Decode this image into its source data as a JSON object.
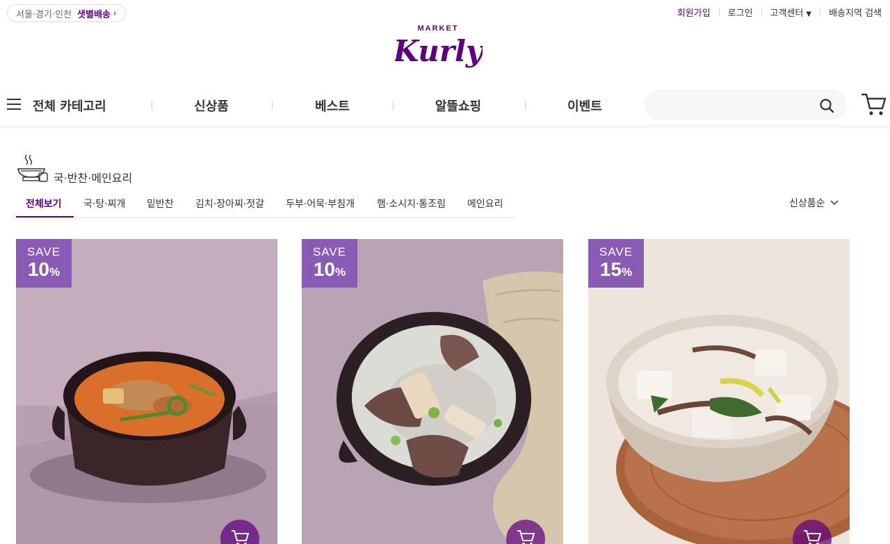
{
  "header": {
    "delivery_region": "서울·경기·인천",
    "delivery_link": "샛별배송",
    "user_menu": [
      "회원가입",
      "로그인",
      "고객센터",
      "배송지역 검색"
    ],
    "logo_small": "MARKET",
    "logo_main": "Kurly"
  },
  "gnb": {
    "all_category": "전체 카테고리",
    "items": [
      "신상품",
      "베스트",
      "알뜰쇼핑",
      "이벤트"
    ],
    "search_placeholder": ""
  },
  "category": {
    "title": "국·반찬·메인요리",
    "tabs": [
      "전체보기",
      "국·탕·찌개",
      "밑반찬",
      "김치·장아찌·젓갈",
      "두부·어묵·부침개",
      "햄·소시지·통조림",
      "메인요리"
    ],
    "active_tab": "전체보기",
    "sort": "신상품순"
  },
  "products": [
    {
      "badge_label": "SAVE",
      "discount": "10",
      "unit": "%"
    },
    {
      "badge_label": "SAVE",
      "discount": "10",
      "unit": "%"
    },
    {
      "badge_label": "SAVE",
      "discount": "15",
      "unit": "%"
    }
  ],
  "colors": {
    "brand": "#5f0080",
    "badge": "#8a5bb5"
  }
}
